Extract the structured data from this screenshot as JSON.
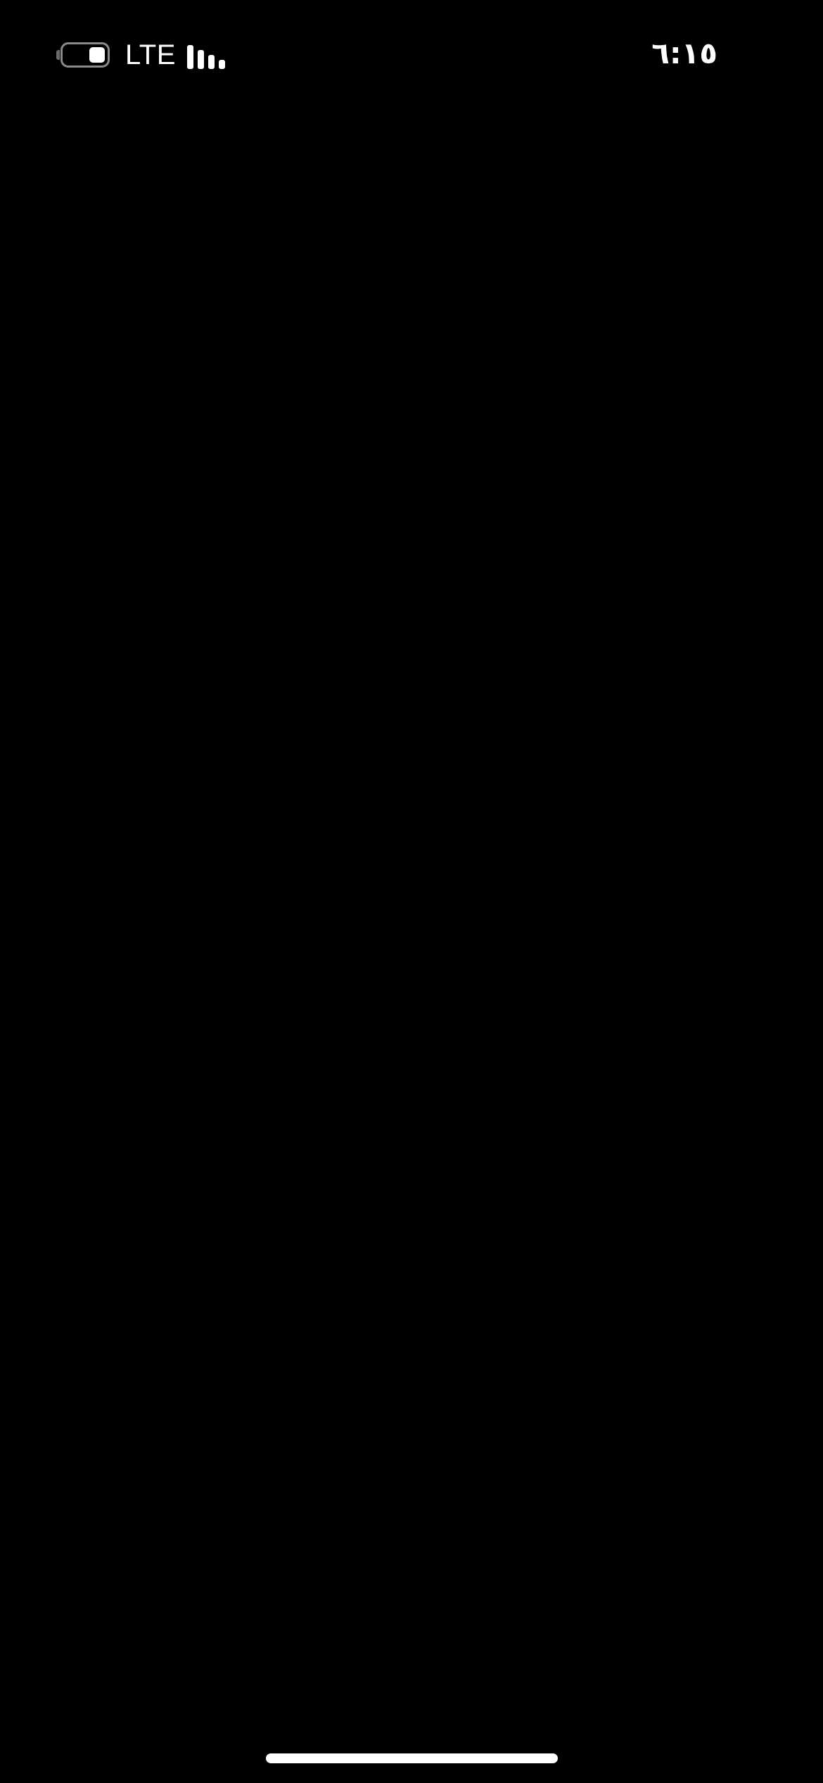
{
  "status_bar": {
    "time": "٦:١٥",
    "network": "LTE",
    "battery_level": 0.4,
    "signal_bars_filled": 4,
    "signal_bars_total": 4
  },
  "colors": {
    "background": "#000000",
    "foreground": "#ffffff",
    "battery_outline": "#8a8a8a"
  }
}
